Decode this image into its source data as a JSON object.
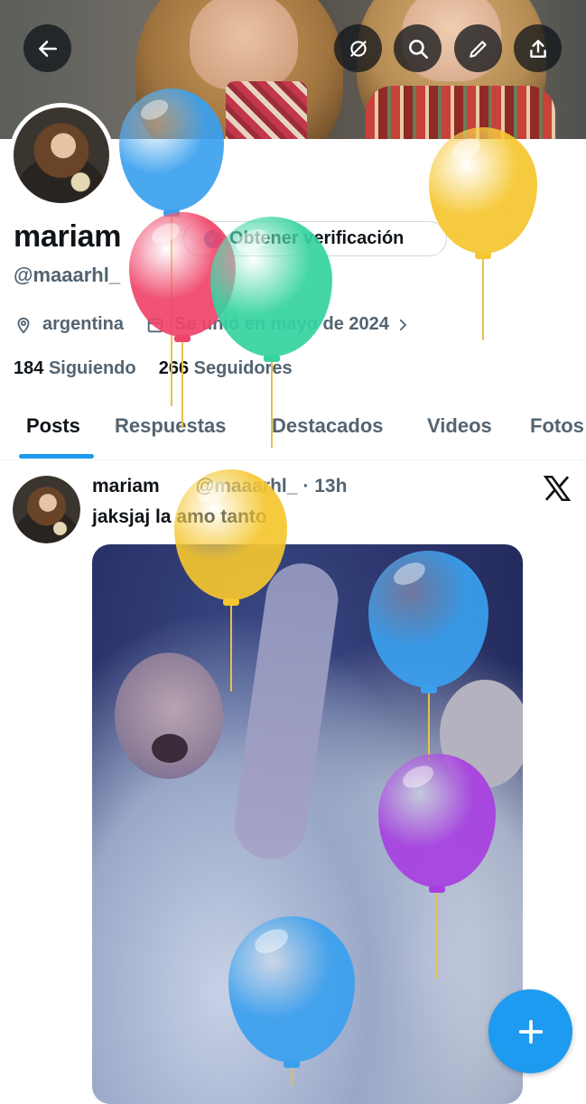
{
  "header": {
    "back_icon": "arrow-left-icon",
    "actions": [
      "grok-icon",
      "search-icon",
      "edit-icon",
      "share-icon"
    ]
  },
  "profile": {
    "display_name": "mariam",
    "handle": "@maaarhl_",
    "verify_button": "Obtener verificación",
    "location": "argentina",
    "joined": "Se unió en mayo de 2024",
    "following_count": "184",
    "following_label": "Siguiendo",
    "followers_count": "266",
    "followers_label": "Seguidores"
  },
  "tabs": [
    {
      "label": "Posts",
      "active": true
    },
    {
      "label": "Respuestas",
      "active": false
    },
    {
      "label": "Destacados",
      "active": false
    },
    {
      "label": "Videos",
      "active": false
    },
    {
      "label": "Fotos",
      "active": false
    }
  ],
  "post": {
    "author": "mariam",
    "handle": "@maaarhl_",
    "time": "· 13h",
    "text": "jaksjaj la amo tanto"
  },
  "colors": {
    "accent": "#1d9bf0",
    "text_primary": "#0f1419",
    "text_secondary": "#536471",
    "balloon_blue": "#3aa0ee",
    "balloon_yellow": "#f5c62e",
    "balloon_red": "#ef4469",
    "balloon_green": "#35d3a0",
    "balloon_purple": "#a73fe0"
  }
}
